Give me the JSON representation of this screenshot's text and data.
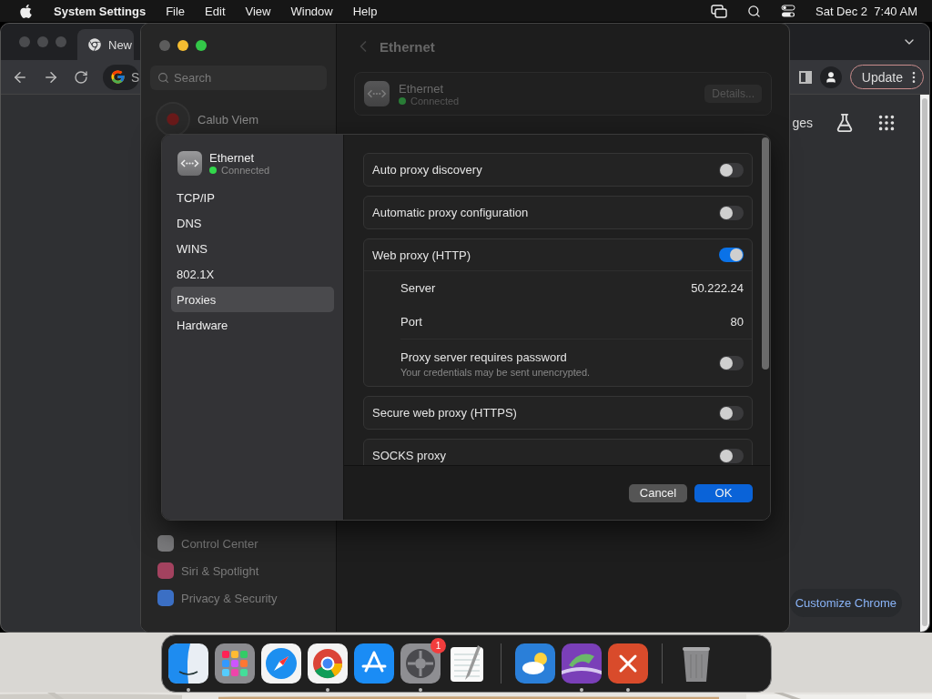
{
  "menu_bar": {
    "app": "System Settings",
    "menus": [
      "File",
      "Edit",
      "View",
      "Window",
      "Help"
    ],
    "clock": "Sat Dec 2  7:40 AM"
  },
  "browser": {
    "tab": "New",
    "address": "S",
    "update_button": "Update",
    "shortcut_label": "ges",
    "customize_button": "Customize Chrome"
  },
  "settings": {
    "search_placeholder": "Search",
    "account": "Calub Viem",
    "title": "Ethernet",
    "device": {
      "name": "Ethernet",
      "status": "Connected"
    },
    "details_button": "Details...",
    "sidebar_items": [
      {
        "label": "Control Center",
        "color": "#7a7a7c"
      },
      {
        "label": "Siri & Spotlight",
        "color": "#a3425f"
      },
      {
        "label": "Privacy & Security",
        "color": "#3b6fc4"
      }
    ]
  },
  "sheet": {
    "device": {
      "name": "Ethernet",
      "status": "Connected"
    },
    "nav": [
      {
        "label": "TCP/IP",
        "selected": false
      },
      {
        "label": "DNS",
        "selected": false
      },
      {
        "label": "WINS",
        "selected": false
      },
      {
        "label": "802.1X",
        "selected": false
      },
      {
        "label": "Proxies",
        "selected": true
      },
      {
        "label": "Hardware",
        "selected": false
      }
    ],
    "proxies": [
      {
        "label": "Auto proxy discovery",
        "on": false
      },
      {
        "label": "Automatic proxy configuration",
        "on": false
      },
      {
        "label": "Web proxy (HTTP)",
        "on": true,
        "fields": [
          {
            "kind": "value",
            "label": "Server",
            "value": "50.222.24"
          },
          {
            "kind": "value",
            "label": "Port",
            "value": "80"
          },
          {
            "kind": "toggle",
            "label": "Proxy server requires password",
            "note": "Your credentials may be sent unencrypted.",
            "on": false
          }
        ]
      },
      {
        "label": "Secure web proxy (HTTPS)",
        "on": false
      },
      {
        "label": "SOCKS proxy",
        "on": false
      }
    ],
    "cancel_button": "Cancel",
    "ok_button": "OK"
  },
  "dock": {
    "apps": [
      {
        "kind": "finder",
        "running": true
      },
      {
        "kind": "launchpad",
        "running": false
      },
      {
        "kind": "safari",
        "running": false
      },
      {
        "kind": "chrome",
        "running": true
      },
      {
        "kind": "appstore",
        "running": false
      },
      {
        "kind": "settings",
        "running": true,
        "badge": "1"
      },
      {
        "kind": "textedit",
        "running": false
      }
    ],
    "recent_apps": [
      {
        "kind": "weather",
        "running": false
      },
      {
        "kind": "purple",
        "running": true
      },
      {
        "kind": "remote",
        "running": true
      }
    ],
    "system_items": [
      {
        "kind": "trash",
        "running": false
      }
    ]
  }
}
